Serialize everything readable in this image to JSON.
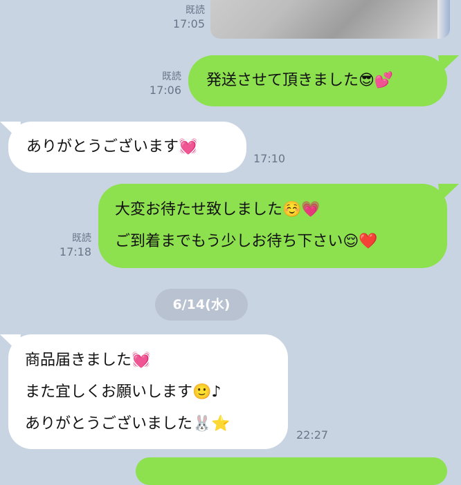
{
  "messages": [
    {
      "id": "m1",
      "direction": "outgoing",
      "type": "image",
      "read_label": "既読",
      "time": "17:05"
    },
    {
      "id": "m2",
      "direction": "outgoing",
      "read_label": "既読",
      "time": "17:06",
      "lines": [
        "発送させて頂きました😎💕"
      ]
    },
    {
      "id": "m3",
      "direction": "incoming",
      "time": "17:10",
      "lines": [
        "ありがとうございます💓"
      ]
    },
    {
      "id": "m4",
      "direction": "outgoing",
      "read_label": "既読",
      "time": "17:18",
      "lines": [
        "大変お待たせ致しました☺️💗",
        "ご到着までもう少しお待ち下さい😌❤️"
      ]
    },
    {
      "id": "m5",
      "direction": "incoming",
      "time": "22:27",
      "lines": [
        "商品届きました💓",
        "また宜しくお願いします🙂♪",
        "ありがとうございました🐰⭐"
      ]
    }
  ],
  "date_separator": "6/14(水)",
  "colors": {
    "background": "#c9d4e3",
    "outgoing_bubble": "#8de04e",
    "incoming_bubble": "#ffffff",
    "meta_text": "#6a7488",
    "date_pill": "#b8c2d0"
  }
}
